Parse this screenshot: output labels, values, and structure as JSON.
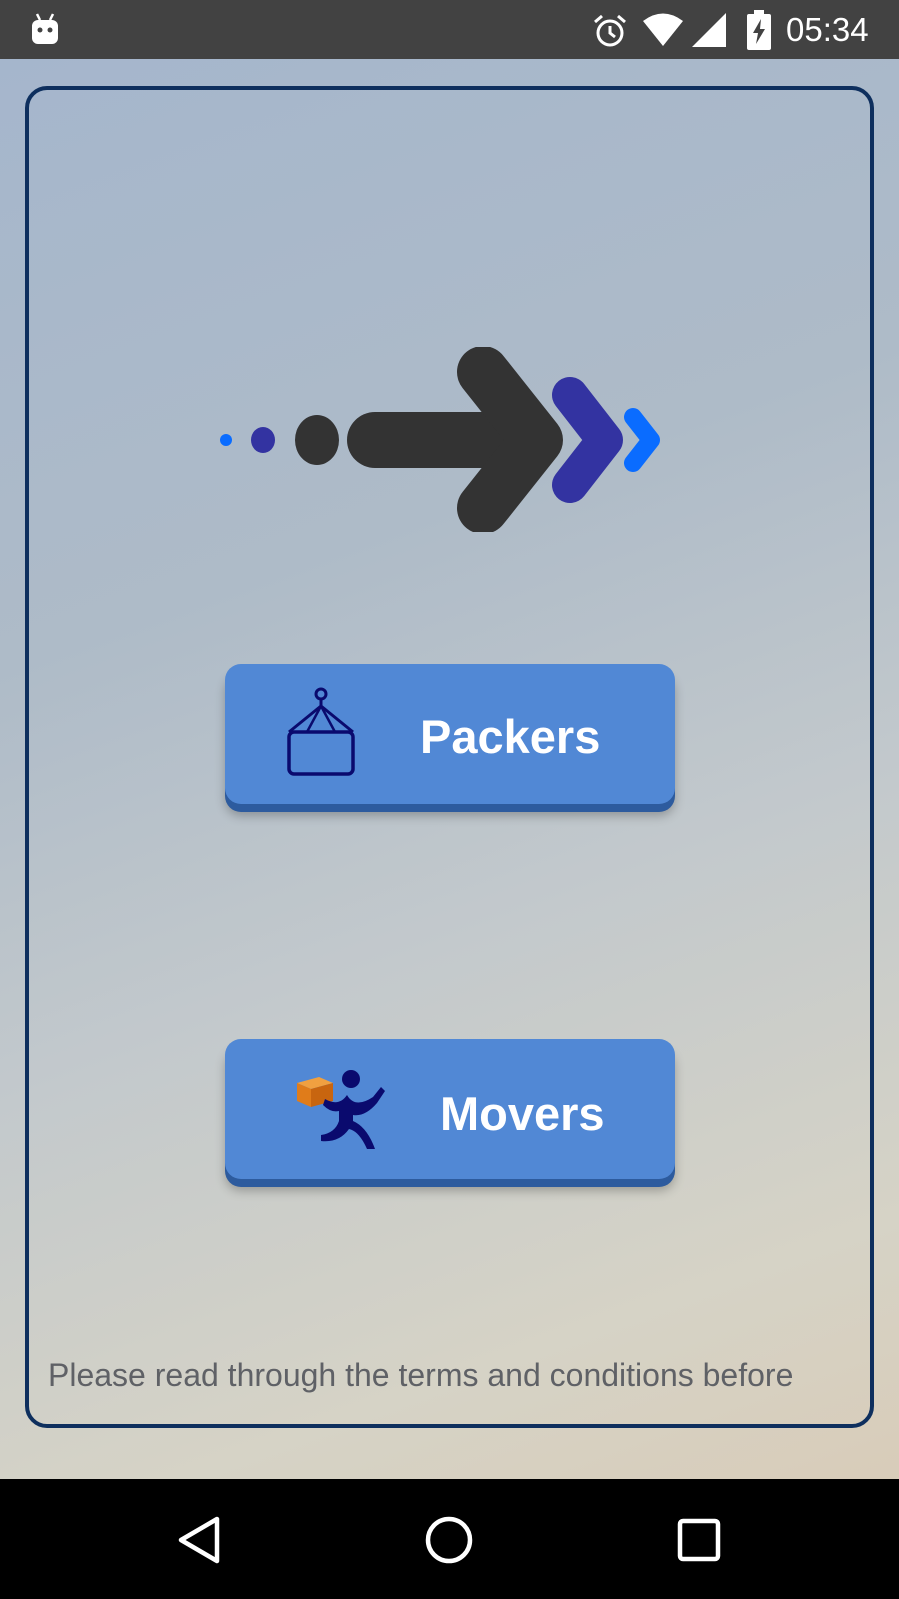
{
  "status_bar": {
    "time": "05:34",
    "icons": [
      "android-debug-icon",
      "alarm-icon",
      "wifi-icon",
      "signal-icon",
      "battery-charging-icon"
    ]
  },
  "logo": {
    "icon": "arrow-chevrons-logo",
    "colors": {
      "dark": "#333333",
      "indigo": "#3333a1",
      "blue": "#0a6cff"
    }
  },
  "buttons": {
    "packers": {
      "label": "Packers",
      "icon": "hanging-box-icon"
    },
    "movers": {
      "label": "Movers",
      "icon": "running-person-box-icon"
    }
  },
  "terms": {
    "text": "Please read through the terms and conditions before"
  },
  "nav_bar": {
    "icons": [
      "back-icon",
      "home-icon",
      "recents-icon"
    ]
  },
  "colors": {
    "button": "#5188d5",
    "frame_border": "#0e2f5e",
    "status_bar": "#424242"
  }
}
